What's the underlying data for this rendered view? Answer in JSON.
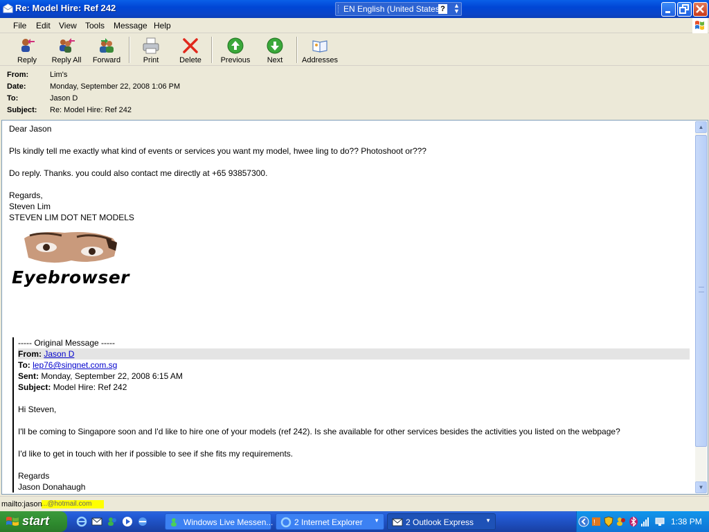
{
  "window": {
    "title": "Re: Model Hire: Ref 242",
    "language_bar": "EN English (United States)",
    "help_glyph": "?",
    "minimize_glyph": "_",
    "maximize_glyph": "□",
    "close_glyph": "✕"
  },
  "menu": [
    "File",
    "Edit",
    "View",
    "Tools",
    "Message",
    "Help"
  ],
  "toolbar": {
    "reply": "Reply",
    "reply_all": "Reply All",
    "forward": "Forward",
    "print": "Print",
    "delete": "Delete",
    "previous": "Previous",
    "next": "Next",
    "addresses": "Addresses"
  },
  "header": {
    "from_label": "From:",
    "from": "Lim's",
    "date_label": "Date:",
    "date": "Monday, September 22, 2008 1:06 PM",
    "to_label": "To:",
    "to": "Jason D",
    "subject_label": "Subject:",
    "subject": "Re: Model Hire: Ref 242"
  },
  "message": {
    "greeting": "Dear Jason",
    "para1": "Pls kindly tell me exactly what kind of events or services you want my model, hwee ling to do??  Photoshoot or???",
    "para2": "Do reply.  Thanks.  you could also contact me directly at +65 93857300.",
    "regards": "Regards,",
    "sender_name": "Steven Lim",
    "company": "STEVEN LIM DOT NET MODELS",
    "logo_text": "Eyebrowser"
  },
  "quoted": {
    "separator": "----- Original Message -----",
    "from_label": "From:",
    "from": "Jason D",
    "to_label": "To:",
    "to": "lep76@singnet.com.sg",
    "sent_label": "Sent:",
    "sent": "Monday, September 22, 2008 6:15 AM",
    "subject_label": "Subject:",
    "subject": "Model Hire: Ref 242",
    "greeting": "Hi Steven,",
    "para1": "I'll be coming to Singapore soon and I'd like to hire one of your models (ref 242). Is she available for other services besides the activities you listed on the webpage?",
    "para2": "I'd like to get in touch with her if possible to see if she fits my requirements.",
    "regards": "Regards",
    "signature": "Jason Donahaugh"
  },
  "statusbar": {
    "text": "mailto:jason",
    "highlight": "...@hotmail.com"
  },
  "taskbar": {
    "start": "start",
    "tasks": [
      "Windows Live Messen...",
      "2 Internet Explorer",
      "2 Outlook Express"
    ],
    "clock": "1:38 PM"
  },
  "colors": {
    "titlebar": "#0a5fe8",
    "link": "#0000cc",
    "highlight": "#ffff00"
  }
}
